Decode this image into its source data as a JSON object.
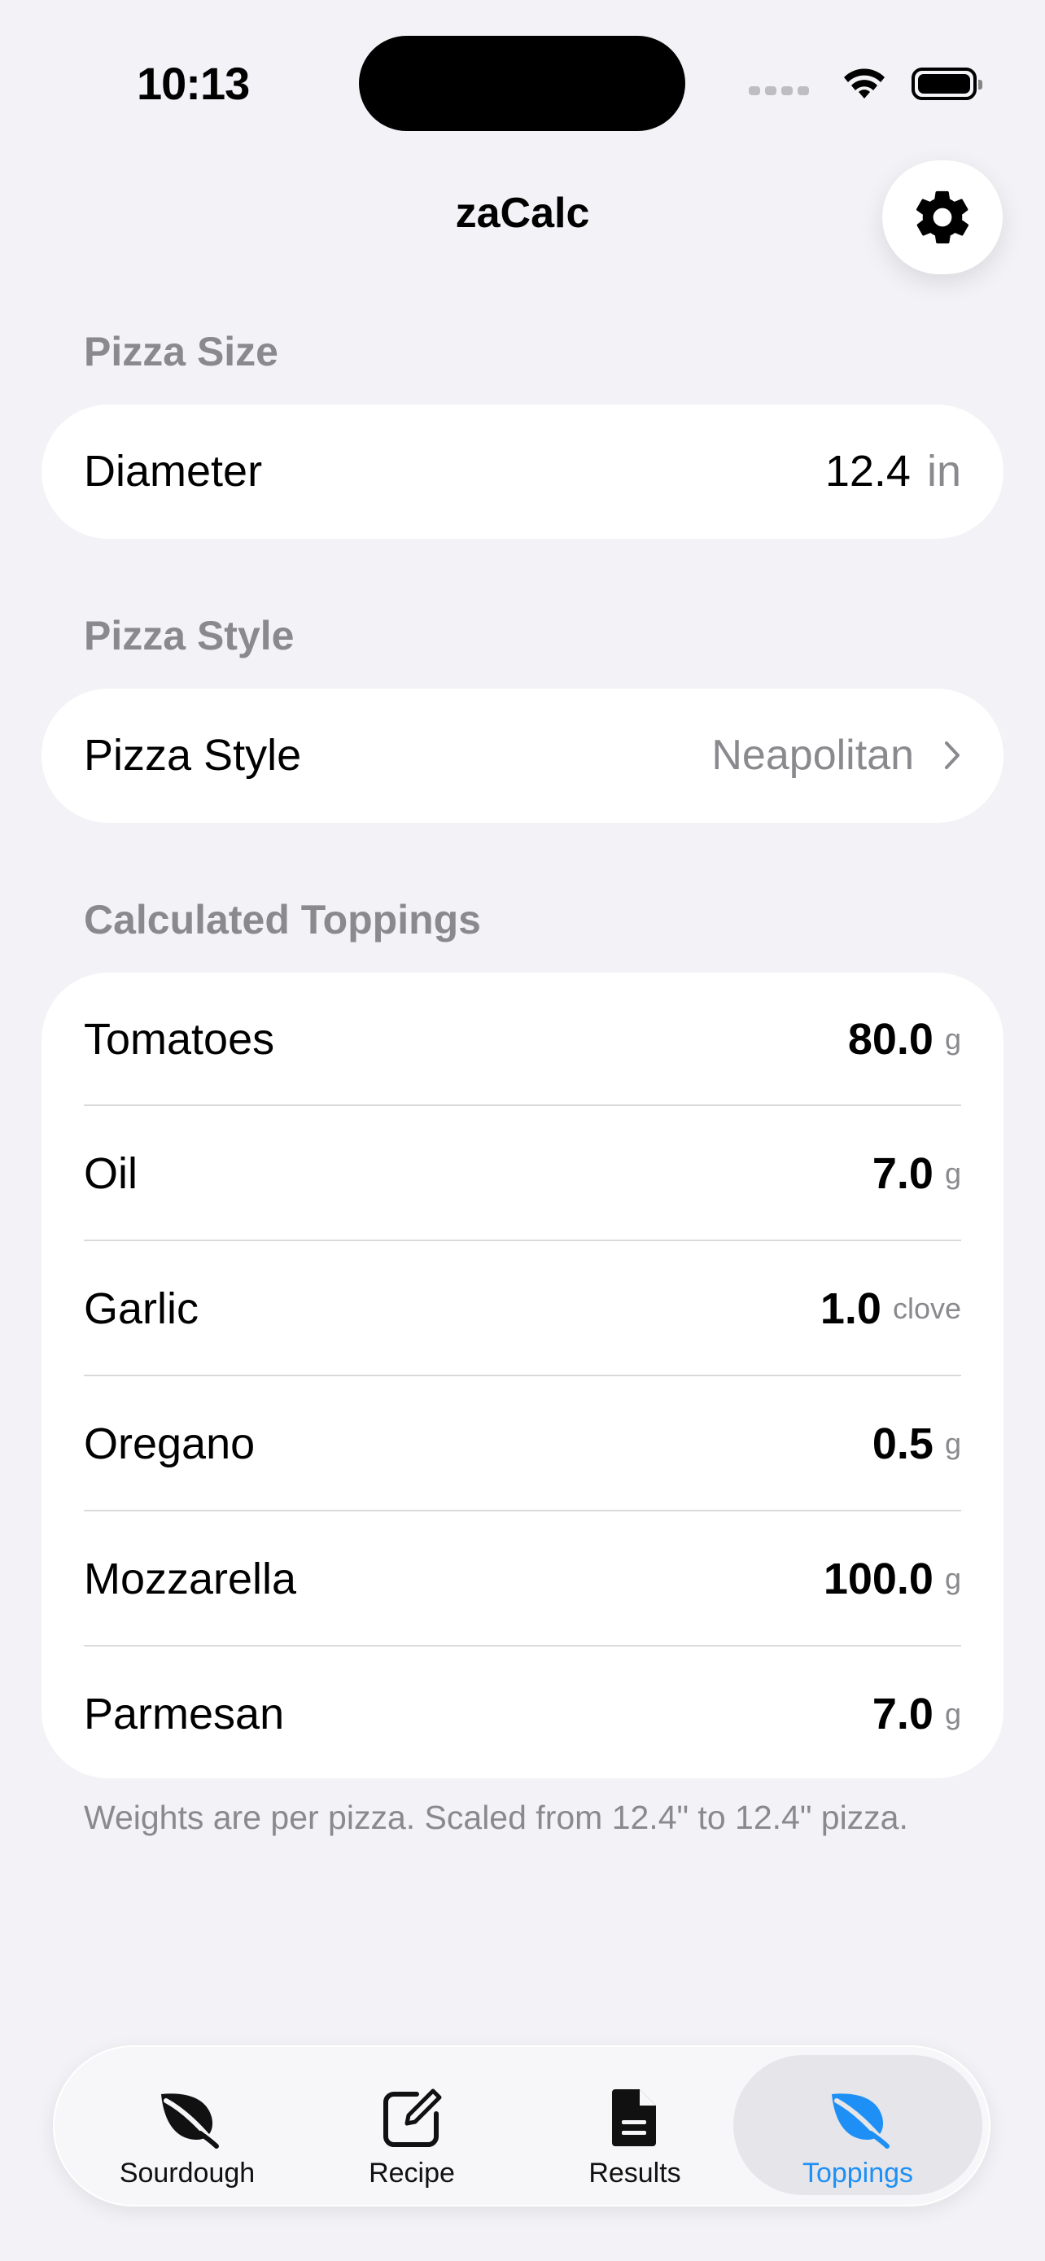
{
  "status_bar": {
    "time": "10:13"
  },
  "nav": {
    "title": "zaCalc"
  },
  "pizza_size": {
    "header": "Pizza Size",
    "label": "Diameter",
    "value": "12.4",
    "unit": "in"
  },
  "pizza_style": {
    "header": "Pizza Style",
    "label": "Pizza Style",
    "value": "Neapolitan"
  },
  "toppings": {
    "header": "Calculated Toppings",
    "items": [
      {
        "name": "Tomatoes",
        "value": "80.0",
        "unit": "g"
      },
      {
        "name": "Oil",
        "value": "7.0",
        "unit": "g"
      },
      {
        "name": "Garlic",
        "value": "1.0",
        "unit": "clove"
      },
      {
        "name": "Oregano",
        "value": "0.5",
        "unit": "g"
      },
      {
        "name": "Mozzarella",
        "value": "100.0",
        "unit": "g"
      },
      {
        "name": "Parmesan",
        "value": "7.0",
        "unit": "g"
      }
    ],
    "footnote": "Weights are per pizza. Scaled from 12.4\" to 12.4\" pizza."
  },
  "tab_bar": {
    "tabs": [
      {
        "label": "Sourdough",
        "icon": "leaf-icon"
      },
      {
        "label": "Recipe",
        "icon": "square-pencil-icon"
      },
      {
        "label": "Results",
        "icon": "document-icon"
      },
      {
        "label": "Toppings",
        "icon": "leaf-icon",
        "active": true
      }
    ]
  },
  "colors": {
    "background": "#F2F2F7",
    "accent": "#1E90F5",
    "secondary_text": "#8A8A8E"
  }
}
